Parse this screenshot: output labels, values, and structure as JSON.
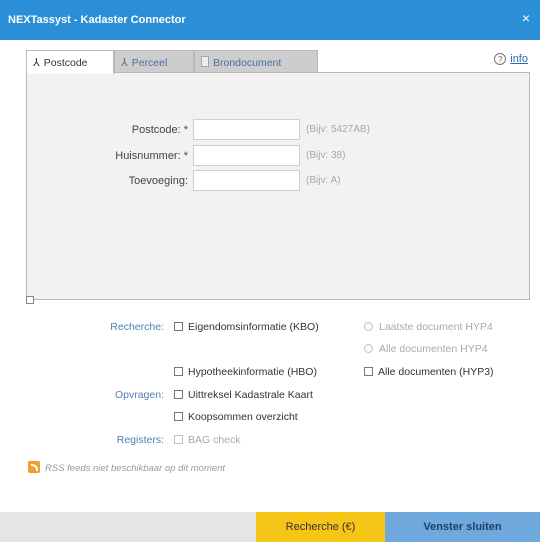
{
  "window": {
    "title": "NEXTassyst - Kadaster Connector",
    "close_glyph": "×"
  },
  "tabs": [
    {
      "label": "Postcode",
      "icon": "person-icon",
      "active": true
    },
    {
      "label": "Perceel",
      "icon": "compass-icon",
      "active": false
    },
    {
      "label": "Brondocument",
      "icon": "document-icon",
      "active": false
    }
  ],
  "info": {
    "label": "info",
    "icon": "help-icon"
  },
  "form": {
    "postcode": {
      "label": "Postcode: *",
      "value": "",
      "hint": "(Bijv: 5427AB)"
    },
    "huisnummer": {
      "label": "Huisnummer: *",
      "value": "",
      "hint": "(Bijv: 38)"
    },
    "toevoeging": {
      "label": "Toevoeging:",
      "value": "",
      "hint": "(Bijv: A)"
    }
  },
  "sections": {
    "recherche": "Recherche:",
    "opvragen": "Opvragen:",
    "registers": "Registers:"
  },
  "options": {
    "kbo": "Eigendomsinformatie (KBO)",
    "hbo": "Hypotheekinformatie (HBO)",
    "kadastrale_kaart": "Uittreksel Kadastrale Kaart",
    "koopsommen": "Koopsommen overzicht",
    "bag": "BAG check",
    "laatste_hyp4": "Laatste document HYP4",
    "alle_hyp4": "Alle documenten HYP4",
    "alle_hyp3": "Alle documenten (HYP3)"
  },
  "rss": {
    "text": "RSS feeds niet beschikbaar op dit moment",
    "icon": "rss-icon"
  },
  "footer": {
    "search_label": "Recherche (€)",
    "close_label": "Venster sluiten"
  },
  "colors": {
    "titlebar": "#2b8fd8",
    "search_button": "#f5c518",
    "close_button": "#6fa8dc",
    "section_label": "#4e7fb8"
  }
}
